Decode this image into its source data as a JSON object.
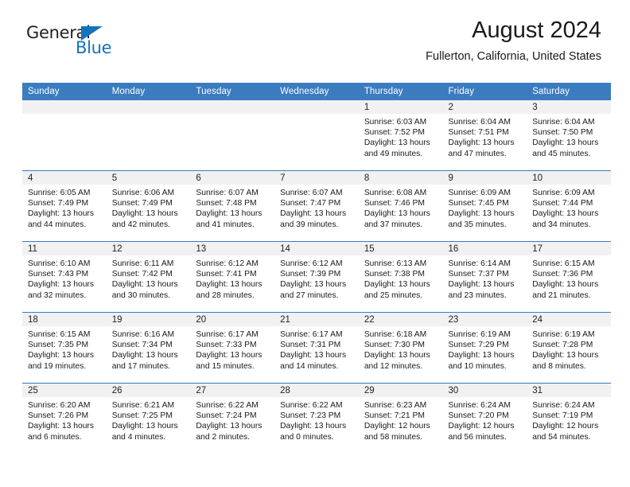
{
  "logo": {
    "primary_text": "General",
    "secondary_text": "Blue",
    "primary_color": "#231f20",
    "secondary_color": "#1473bd"
  },
  "header": {
    "title": "August 2024",
    "subtitle": "Fullerton, California, United States"
  },
  "theme": {
    "header_blue": "#3b7cc0",
    "day_band_gray": "#f1f1f1",
    "text_color": "#1a1a1a"
  },
  "calendar": {
    "weekday_headers": [
      "Sunday",
      "Monday",
      "Tuesday",
      "Wednesday",
      "Thursday",
      "Friday",
      "Saturday"
    ],
    "weeks": [
      [
        {
          "day": "",
          "sunrise": "",
          "sunset": "",
          "daylight": ""
        },
        {
          "day": "",
          "sunrise": "",
          "sunset": "",
          "daylight": ""
        },
        {
          "day": "",
          "sunrise": "",
          "sunset": "",
          "daylight": ""
        },
        {
          "day": "",
          "sunrise": "",
          "sunset": "",
          "daylight": ""
        },
        {
          "day": "1",
          "sunrise": "Sunrise: 6:03 AM",
          "sunset": "Sunset: 7:52 PM",
          "daylight": "Daylight: 13 hours and 49 minutes."
        },
        {
          "day": "2",
          "sunrise": "Sunrise: 6:04 AM",
          "sunset": "Sunset: 7:51 PM",
          "daylight": "Daylight: 13 hours and 47 minutes."
        },
        {
          "day": "3",
          "sunrise": "Sunrise: 6:04 AM",
          "sunset": "Sunset: 7:50 PM",
          "daylight": "Daylight: 13 hours and 45 minutes."
        }
      ],
      [
        {
          "day": "4",
          "sunrise": "Sunrise: 6:05 AM",
          "sunset": "Sunset: 7:49 PM",
          "daylight": "Daylight: 13 hours and 44 minutes."
        },
        {
          "day": "5",
          "sunrise": "Sunrise: 6:06 AM",
          "sunset": "Sunset: 7:49 PM",
          "daylight": "Daylight: 13 hours and 42 minutes."
        },
        {
          "day": "6",
          "sunrise": "Sunrise: 6:07 AM",
          "sunset": "Sunset: 7:48 PM",
          "daylight": "Daylight: 13 hours and 41 minutes."
        },
        {
          "day": "7",
          "sunrise": "Sunrise: 6:07 AM",
          "sunset": "Sunset: 7:47 PM",
          "daylight": "Daylight: 13 hours and 39 minutes."
        },
        {
          "day": "8",
          "sunrise": "Sunrise: 6:08 AM",
          "sunset": "Sunset: 7:46 PM",
          "daylight": "Daylight: 13 hours and 37 minutes."
        },
        {
          "day": "9",
          "sunrise": "Sunrise: 6:09 AM",
          "sunset": "Sunset: 7:45 PM",
          "daylight": "Daylight: 13 hours and 35 minutes."
        },
        {
          "day": "10",
          "sunrise": "Sunrise: 6:09 AM",
          "sunset": "Sunset: 7:44 PM",
          "daylight": "Daylight: 13 hours and 34 minutes."
        }
      ],
      [
        {
          "day": "11",
          "sunrise": "Sunrise: 6:10 AM",
          "sunset": "Sunset: 7:43 PM",
          "daylight": "Daylight: 13 hours and 32 minutes."
        },
        {
          "day": "12",
          "sunrise": "Sunrise: 6:11 AM",
          "sunset": "Sunset: 7:42 PM",
          "daylight": "Daylight: 13 hours and 30 minutes."
        },
        {
          "day": "13",
          "sunrise": "Sunrise: 6:12 AM",
          "sunset": "Sunset: 7:41 PM",
          "daylight": "Daylight: 13 hours and 28 minutes."
        },
        {
          "day": "14",
          "sunrise": "Sunrise: 6:12 AM",
          "sunset": "Sunset: 7:39 PM",
          "daylight": "Daylight: 13 hours and 27 minutes."
        },
        {
          "day": "15",
          "sunrise": "Sunrise: 6:13 AM",
          "sunset": "Sunset: 7:38 PM",
          "daylight": "Daylight: 13 hours and 25 minutes."
        },
        {
          "day": "16",
          "sunrise": "Sunrise: 6:14 AM",
          "sunset": "Sunset: 7:37 PM",
          "daylight": "Daylight: 13 hours and 23 minutes."
        },
        {
          "day": "17",
          "sunrise": "Sunrise: 6:15 AM",
          "sunset": "Sunset: 7:36 PM",
          "daylight": "Daylight: 13 hours and 21 minutes."
        }
      ],
      [
        {
          "day": "18",
          "sunrise": "Sunrise: 6:15 AM",
          "sunset": "Sunset: 7:35 PM",
          "daylight": "Daylight: 13 hours and 19 minutes."
        },
        {
          "day": "19",
          "sunrise": "Sunrise: 6:16 AM",
          "sunset": "Sunset: 7:34 PM",
          "daylight": "Daylight: 13 hours and 17 minutes."
        },
        {
          "day": "20",
          "sunrise": "Sunrise: 6:17 AM",
          "sunset": "Sunset: 7:33 PM",
          "daylight": "Daylight: 13 hours and 15 minutes."
        },
        {
          "day": "21",
          "sunrise": "Sunrise: 6:17 AM",
          "sunset": "Sunset: 7:31 PM",
          "daylight": "Daylight: 13 hours and 14 minutes."
        },
        {
          "day": "22",
          "sunrise": "Sunrise: 6:18 AM",
          "sunset": "Sunset: 7:30 PM",
          "daylight": "Daylight: 13 hours and 12 minutes."
        },
        {
          "day": "23",
          "sunrise": "Sunrise: 6:19 AM",
          "sunset": "Sunset: 7:29 PM",
          "daylight": "Daylight: 13 hours and 10 minutes."
        },
        {
          "day": "24",
          "sunrise": "Sunrise: 6:19 AM",
          "sunset": "Sunset: 7:28 PM",
          "daylight": "Daylight: 13 hours and 8 minutes."
        }
      ],
      [
        {
          "day": "25",
          "sunrise": "Sunrise: 6:20 AM",
          "sunset": "Sunset: 7:26 PM",
          "daylight": "Daylight: 13 hours and 6 minutes."
        },
        {
          "day": "26",
          "sunrise": "Sunrise: 6:21 AM",
          "sunset": "Sunset: 7:25 PM",
          "daylight": "Daylight: 13 hours and 4 minutes."
        },
        {
          "day": "27",
          "sunrise": "Sunrise: 6:22 AM",
          "sunset": "Sunset: 7:24 PM",
          "daylight": "Daylight: 13 hours and 2 minutes."
        },
        {
          "day": "28",
          "sunrise": "Sunrise: 6:22 AM",
          "sunset": "Sunset: 7:23 PM",
          "daylight": "Daylight: 13 hours and 0 minutes."
        },
        {
          "day": "29",
          "sunrise": "Sunrise: 6:23 AM",
          "sunset": "Sunset: 7:21 PM",
          "daylight": "Daylight: 12 hours and 58 minutes."
        },
        {
          "day": "30",
          "sunrise": "Sunrise: 6:24 AM",
          "sunset": "Sunset: 7:20 PM",
          "daylight": "Daylight: 12 hours and 56 minutes."
        },
        {
          "day": "31",
          "sunrise": "Sunrise: 6:24 AM",
          "sunset": "Sunset: 7:19 PM",
          "daylight": "Daylight: 12 hours and 54 minutes."
        }
      ]
    ]
  }
}
